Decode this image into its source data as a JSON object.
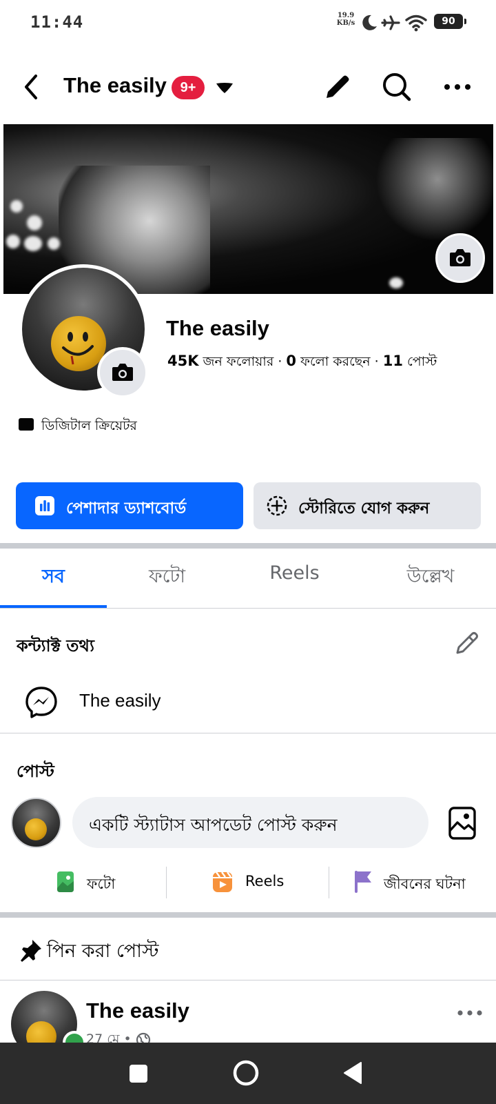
{
  "status_bar": {
    "time": "11:44",
    "net_speed_value": "19.9",
    "net_speed_unit": "KB/s",
    "battery": "90"
  },
  "header": {
    "page_name": "The easily",
    "notification_badge": "9+"
  },
  "profile": {
    "name": "The easily",
    "followers_count": "45K",
    "followers_label": "জন ফলোয়ার",
    "following_count": "0",
    "following_label": "ফলো করছেন",
    "posts_count": "11",
    "posts_label": "পোস্ট",
    "separator": "·",
    "category": "ডিজিটাল ক্রিয়েটর"
  },
  "actions": {
    "dashboard_label": "পেশাদার ড্যাশবোর্ড",
    "story_label": "স্টোরিতে যোগ করুন"
  },
  "tabs": [
    "সব",
    "ফটো",
    "Reels",
    "উল্লেখ"
  ],
  "active_tab_index": 0,
  "contact": {
    "title": "কন্ট্যাক্ট তথ্য",
    "messenger_name": "The easily"
  },
  "posts": {
    "title": "পোস্ট",
    "status_placeholder": "একটি স্ট্যাটাস আপডেট পোস্ট করুন",
    "photo_label": "ফটো",
    "reels_label": "Reels",
    "life_event_label": "জীবনের ঘটনা"
  },
  "pinned": {
    "title": "পিন করা পোস্ট",
    "author": "The easily",
    "date": "27 মে",
    "dot": "•"
  },
  "colors": {
    "primary_blue": "#0866ff",
    "badge_red": "#e41e3f",
    "secondary_gray": "#e4e6eb",
    "photo_green": "#45bd62",
    "reels_orange": "#f7923b",
    "life_event_purple": "#8c72cb",
    "online_green": "#31a24c"
  }
}
